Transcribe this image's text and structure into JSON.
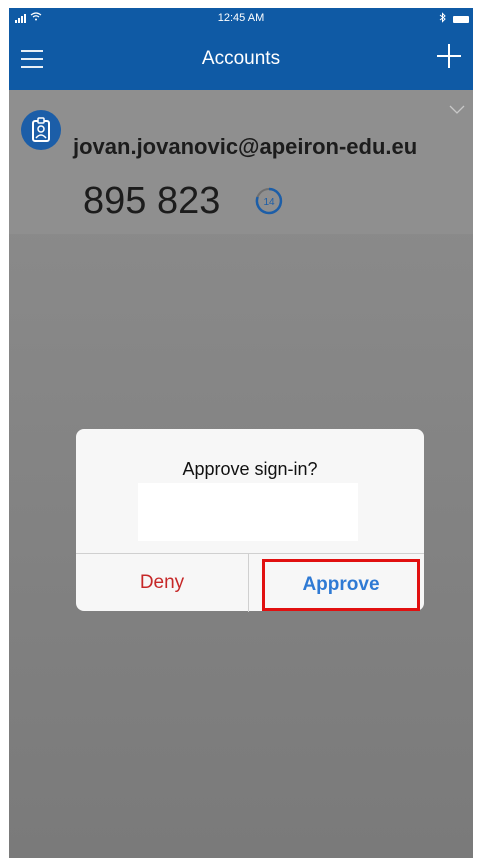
{
  "status_bar": {
    "time": "12:45 AM"
  },
  "nav": {
    "title": "Accounts"
  },
  "account": {
    "email": "jovan.jovanovic@apeiron-edu.eu",
    "code": "895 823",
    "timer": "14"
  },
  "dialog": {
    "title": "Approve sign-in?",
    "deny_label": "Deny",
    "approve_label": "Approve"
  },
  "colors": {
    "nav": "#0f5aa5",
    "deny": "#c62828",
    "approve": "#2f7ad4",
    "highlight": "#e11010"
  },
  "icons": [
    "signal-icon",
    "wifi-icon",
    "bluetooth-icon",
    "battery-icon",
    "menu-icon",
    "add-icon",
    "badge-icon",
    "chevron-down-icon",
    "timer-icon"
  ]
}
